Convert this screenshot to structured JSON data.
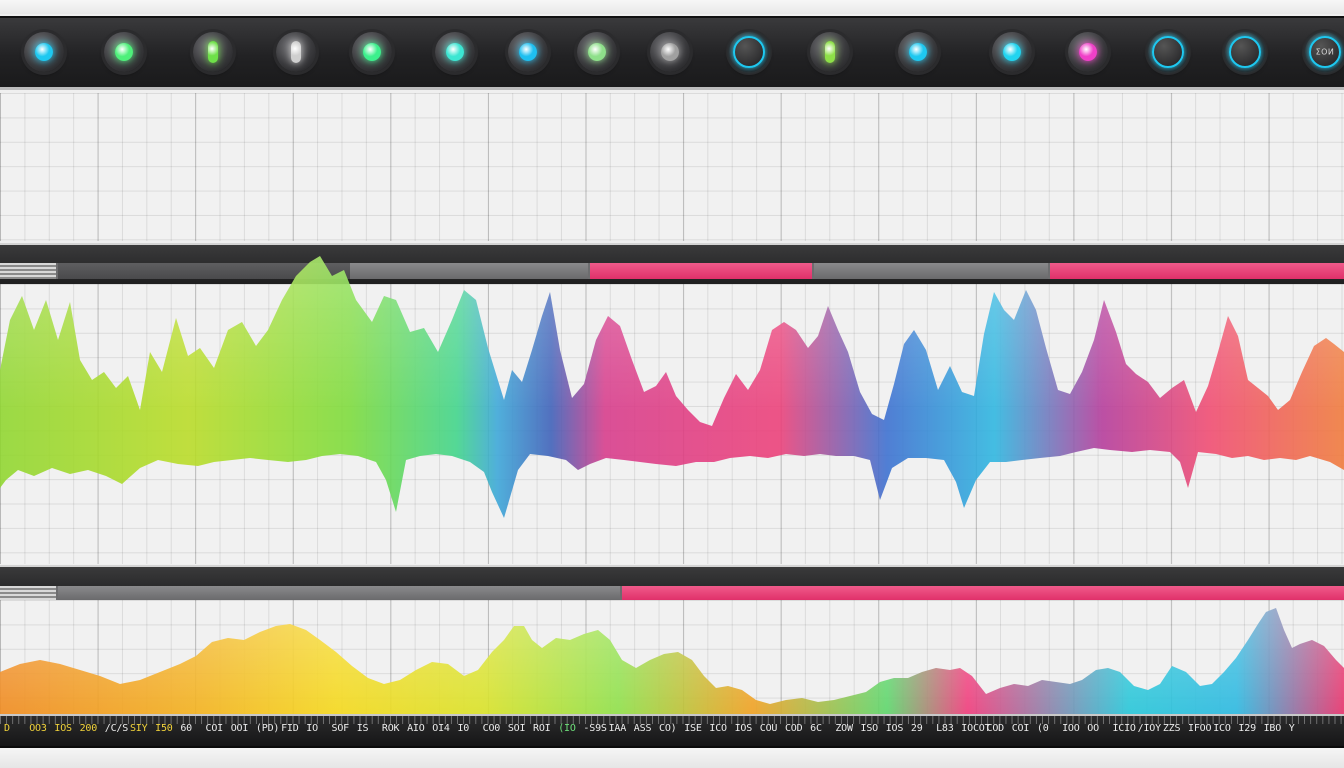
{
  "knobs": [
    {
      "name": "knob-1-icon",
      "led": "#1ec8f0",
      "style": "dot"
    },
    {
      "name": "knob-2-icon",
      "led": "#4ef07a",
      "style": "dot"
    },
    {
      "name": "knob-3-icon",
      "led": "#6ee048",
      "style": "pointer"
    },
    {
      "name": "knob-4-icon",
      "led": "#cfcfcf",
      "style": "pointer"
    },
    {
      "name": "knob-5-icon",
      "led": "#3cf08c",
      "style": "dot"
    },
    {
      "name": "knob-6-icon",
      "led": "#3ce6d2",
      "style": "dot"
    },
    {
      "name": "knob-7-icon",
      "led": "#1ebff0",
      "style": "dot"
    },
    {
      "name": "knob-8-icon",
      "led": "#8ee08a",
      "style": "dot"
    },
    {
      "name": "knob-9-icon",
      "led": "#a0a0a0",
      "style": "dot"
    },
    {
      "name": "knob-10-icon",
      "led": "#1ec8f0",
      "style": "ring"
    },
    {
      "name": "knob-11-icon",
      "led": "#8ee048",
      "style": "pointer"
    },
    {
      "name": "knob-12-icon",
      "led": "#1ec8f0",
      "style": "dot"
    },
    {
      "name": "knob-13-icon",
      "led": "#20d4f0",
      "style": "dot"
    },
    {
      "name": "knob-14-icon",
      "led": "#f040c8",
      "style": "dot"
    },
    {
      "name": "knob-15-icon",
      "led": "#1ec8f0",
      "style": "ring"
    },
    {
      "name": "knob-16-icon",
      "led": "#1ec8f0",
      "style": "ring"
    },
    {
      "name": "knob-17-icon",
      "led": "#1ec8f0",
      "style": "ring",
      "label": "ΣOИ"
    }
  ],
  "timeline": {
    "labels": [
      {
        "text": "D",
        "color": "yellow"
      },
      {
        "text": "OO3",
        "color": "yellow"
      },
      {
        "text": "IOS",
        "color": "yellow"
      },
      {
        "text": "200",
        "color": "yellow"
      },
      {
        "text": "/C/S",
        "color": "white"
      },
      {
        "text": "SIY",
        "color": "yellow"
      },
      {
        "text": "I50",
        "color": "yellow"
      },
      {
        "text": "60",
        "color": "white"
      },
      {
        "text": "COI",
        "color": "white"
      },
      {
        "text": "OOI",
        "color": "white"
      },
      {
        "text": "(PD)",
        "color": "white"
      },
      {
        "text": "FID",
        "color": "white"
      },
      {
        "text": "IO",
        "color": "white"
      },
      {
        "text": "SOF",
        "color": "white"
      },
      {
        "text": "IS",
        "color": "white"
      },
      {
        "text": "ROK",
        "color": "white"
      },
      {
        "text": "AIO",
        "color": "white"
      },
      {
        "text": "OI4",
        "color": "white"
      },
      {
        "text": "I0",
        "color": "white"
      },
      {
        "text": "CO0",
        "color": "white"
      },
      {
        "text": "SOI",
        "color": "white"
      },
      {
        "text": "ROI",
        "color": "white"
      },
      {
        "text": "(IO",
        "color": "green"
      },
      {
        "text": "-S9S",
        "color": "white"
      },
      {
        "text": "IAA",
        "color": "white"
      },
      {
        "text": "ASS",
        "color": "white"
      },
      {
        "text": "CO)",
        "color": "white"
      },
      {
        "text": "ISE",
        "color": "white"
      },
      {
        "text": "ICO",
        "color": "white"
      },
      {
        "text": "IOS",
        "color": "white"
      },
      {
        "text": "COU",
        "color": "white"
      },
      {
        "text": "COD",
        "color": "white"
      },
      {
        "text": "6C",
        "color": "white"
      },
      {
        "text": "ZOW",
        "color": "white"
      },
      {
        "text": "ISO",
        "color": "white"
      },
      {
        "text": "IOS",
        "color": "white"
      },
      {
        "text": "29",
        "color": "white"
      },
      {
        "text": "L83",
        "color": "white"
      },
      {
        "text": "IOCOT",
        "color": "white"
      },
      {
        "text": "COD",
        "color": "white"
      },
      {
        "text": "COI",
        "color": "white"
      },
      {
        "text": "(0",
        "color": "white"
      },
      {
        "text": "IOO",
        "color": "white"
      },
      {
        "text": "OO",
        "color": "white"
      },
      {
        "text": "ICIO",
        "color": "white"
      },
      {
        "text": "/IOY",
        "color": "white"
      },
      {
        "text": "ZZS",
        "color": "white"
      },
      {
        "text": "IFOO",
        "color": "white"
      },
      {
        "text": "ICO",
        "color": "white"
      },
      {
        "text": "I29",
        "color": "white"
      },
      {
        "text": "IBO",
        "color": "white"
      },
      {
        "text": "Y",
        "color": "white"
      }
    ]
  }
}
